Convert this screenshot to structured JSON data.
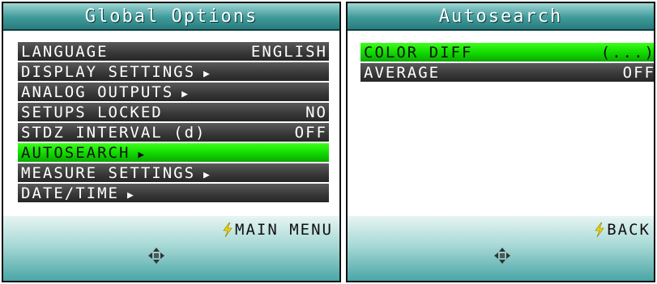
{
  "left_screen": {
    "title": "Global Options",
    "items": [
      {
        "label": "LANGUAGE",
        "value": "ENGLISH",
        "arrow": "",
        "selected": false
      },
      {
        "label": "DISPLAY SETTINGS",
        "value": "",
        "arrow": "▶",
        "selected": false
      },
      {
        "label": "ANALOG OUTPUTS",
        "value": "",
        "arrow": "▶",
        "selected": false
      },
      {
        "label": "SETUPS LOCKED",
        "value": "NO",
        "arrow": "",
        "selected": false
      },
      {
        "label": "STDZ INTERVAL (d)",
        "value": "OFF",
        "arrow": "",
        "selected": false
      },
      {
        "label": "AUTOSEARCH",
        "value": "",
        "arrow": "▶",
        "selected": true
      },
      {
        "label": "MEASURE SETTINGS",
        "value": "",
        "arrow": "▶",
        "selected": false
      },
      {
        "label": "DATE/TIME",
        "value": "",
        "arrow": "▶",
        "selected": false
      }
    ],
    "softkey_label": "MAIN MENU",
    "softkey_icon": "lightning-bolt-icon",
    "nav_icon": "dpad-icon"
  },
  "right_screen": {
    "title": "Autosearch",
    "items": [
      {
        "label": "COLOR DIFF",
        "value": "(...)",
        "arrow": "",
        "selected": true
      },
      {
        "label": "AVERAGE",
        "value": "OFF",
        "arrow": "",
        "selected": false
      }
    ],
    "softkey_label": "BACK",
    "softkey_icon": "lightning-bolt-icon",
    "nav_icon": "dpad-icon"
  },
  "colors": {
    "selection": "#10d800",
    "item_bg": "#3a3a3a",
    "title_bg": "#3f9a9a",
    "bolt": "#f0d400"
  }
}
